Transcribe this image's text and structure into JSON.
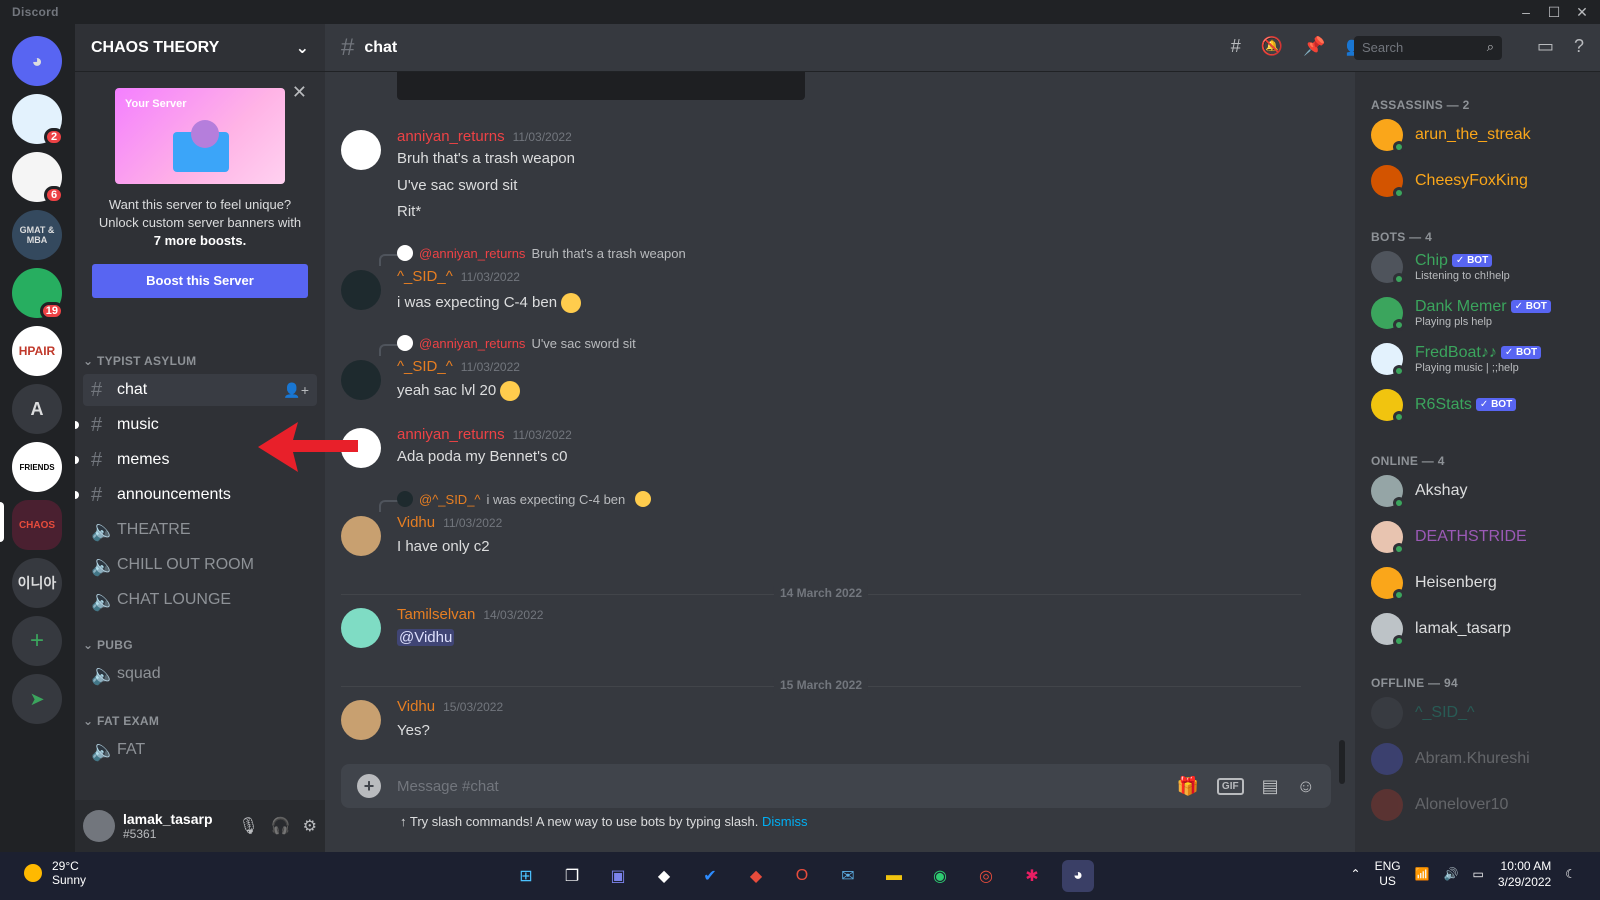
{
  "app": {
    "title": "Discord"
  },
  "server": {
    "name": "CHAOS THEORY"
  },
  "boost_card": {
    "image_tag": "Your Server",
    "text_line1": "Want this server to feel unique?",
    "text_line2": "Unlock custom server banners with",
    "text_bold": "7 more boosts.",
    "button": "Boost this Server"
  },
  "guilds": [
    {
      "label": "",
      "badge": ""
    },
    {
      "label": "",
      "badge": "2"
    },
    {
      "label": "",
      "badge": "6"
    },
    {
      "label": "GMAT & MBA",
      "badge": ""
    },
    {
      "label": "",
      "badge": "19"
    },
    {
      "label": "HPAIR",
      "badge": ""
    },
    {
      "label": "A",
      "badge": ""
    },
    {
      "label": "FRIENDS",
      "badge": ""
    },
    {
      "label": "CHAOS",
      "badge": ""
    },
    {
      "label": "이니아",
      "badge": ""
    }
  ],
  "categories": [
    "TYPIST ASYLUM",
    "PUBG",
    "FAT EXAM"
  ],
  "channels": {
    "chat": "chat",
    "music": "music",
    "memes": "memes",
    "announcements": "announcements",
    "theatre": "THEATRE",
    "chill": "CHILL OUT ROOM",
    "lounge": "CHAT LOUNGE",
    "squad": "squad",
    "fat": "FAT"
  },
  "user": {
    "name": "lamak_tasarp",
    "tag": "#5361"
  },
  "topbar": {
    "channel": "chat",
    "search_placeholder": "Search"
  },
  "messages": [
    {
      "author": "anniyan_returns",
      "ts": "11/03/2022",
      "lines": [
        "Bruh that's a trash weapon",
        "U've sac sword sit",
        "Rit*"
      ]
    },
    {
      "reply_to": "@anniyan_returns",
      "reply_text": "Bruh that's a trash weapon",
      "author": "^_SID_^",
      "ts": "11/03/2022",
      "text": "i was expecting C-4 ben"
    },
    {
      "reply_to": "@anniyan_returns",
      "reply_text": "U've sac sword sit",
      "author": "^_SID_^",
      "ts": "11/03/2022",
      "text": "yeah sac lvl 20"
    },
    {
      "author": "anniyan_returns",
      "ts": "11/03/2022",
      "text": "Ada poda my Bennet's c0"
    },
    {
      "reply_to": "@^_SID_^",
      "reply_text": "i was expecting C-4 ben",
      "author": "Vidhu",
      "ts": "11/03/2022",
      "text": "I have only c2"
    },
    {
      "author": "Tamilselvan",
      "ts": "14/03/2022",
      "text": "@Vidhu"
    },
    {
      "author": "Vidhu",
      "ts": "15/03/2022",
      "text": "Yes?"
    }
  ],
  "dividers": [
    "14 March 2022",
    "15 March 2022"
  ],
  "composer": {
    "placeholder": "Message #chat",
    "gif": "GIF"
  },
  "slash_tip": {
    "text": "Try slash commands! A new way to use bots by typing slash.",
    "dismiss": "Dismiss"
  },
  "member_groups": [
    "ASSASSINS — 2",
    "BOTS — 4",
    "ONLINE — 4",
    "OFFLINE — 94"
  ],
  "members": {
    "assassins": [
      {
        "name": "arun_the_streak",
        "color": "#faa61a"
      },
      {
        "name": "CheesyFoxKing",
        "color": "#faa61a"
      }
    ],
    "bots": [
      {
        "name": "Chip",
        "sub": "Listening to ch!help",
        "color": "#3ba55d",
        "badge": "✓ BOT"
      },
      {
        "name": "Dank Memer",
        "sub": "Playing pls help",
        "color": "#3ba55d",
        "badge": "✓ BOT"
      },
      {
        "name": "FredBoat♪♪",
        "sub": "Playing music | ;;help",
        "color": "#3ba55d",
        "badge": "✓ BOT"
      },
      {
        "name": "R6Stats",
        "sub": "",
        "color": "#3ba55d",
        "badge": "✓ BOT"
      }
    ],
    "online": [
      {
        "name": "Akshay",
        "color": "#dcddde"
      },
      {
        "name": "DEATHSTRIDE",
        "color": "#9b59b6"
      },
      {
        "name": "Heisenberg",
        "color": "#dcddde"
      },
      {
        "name": "lamak_tasarp",
        "color": "#dcddde"
      }
    ],
    "offline": [
      {
        "name": "^_SID_^",
        "color": "#1abc9c"
      },
      {
        "name": "Abram.Khureshi",
        "color": "#dcddde"
      },
      {
        "name": "Alonelover10",
        "color": "#dcddde"
      }
    ]
  },
  "taskbar": {
    "temp": "29°C",
    "condition": "Sunny",
    "lang1": "ENG",
    "lang2": "US",
    "time": "10:00 AM",
    "date": "3/29/2022"
  },
  "colors": {
    "accent": "#5865f2",
    "red_user": "#ed4245",
    "orange_user": "#e67e22",
    "green_bot": "#3ba55d"
  }
}
